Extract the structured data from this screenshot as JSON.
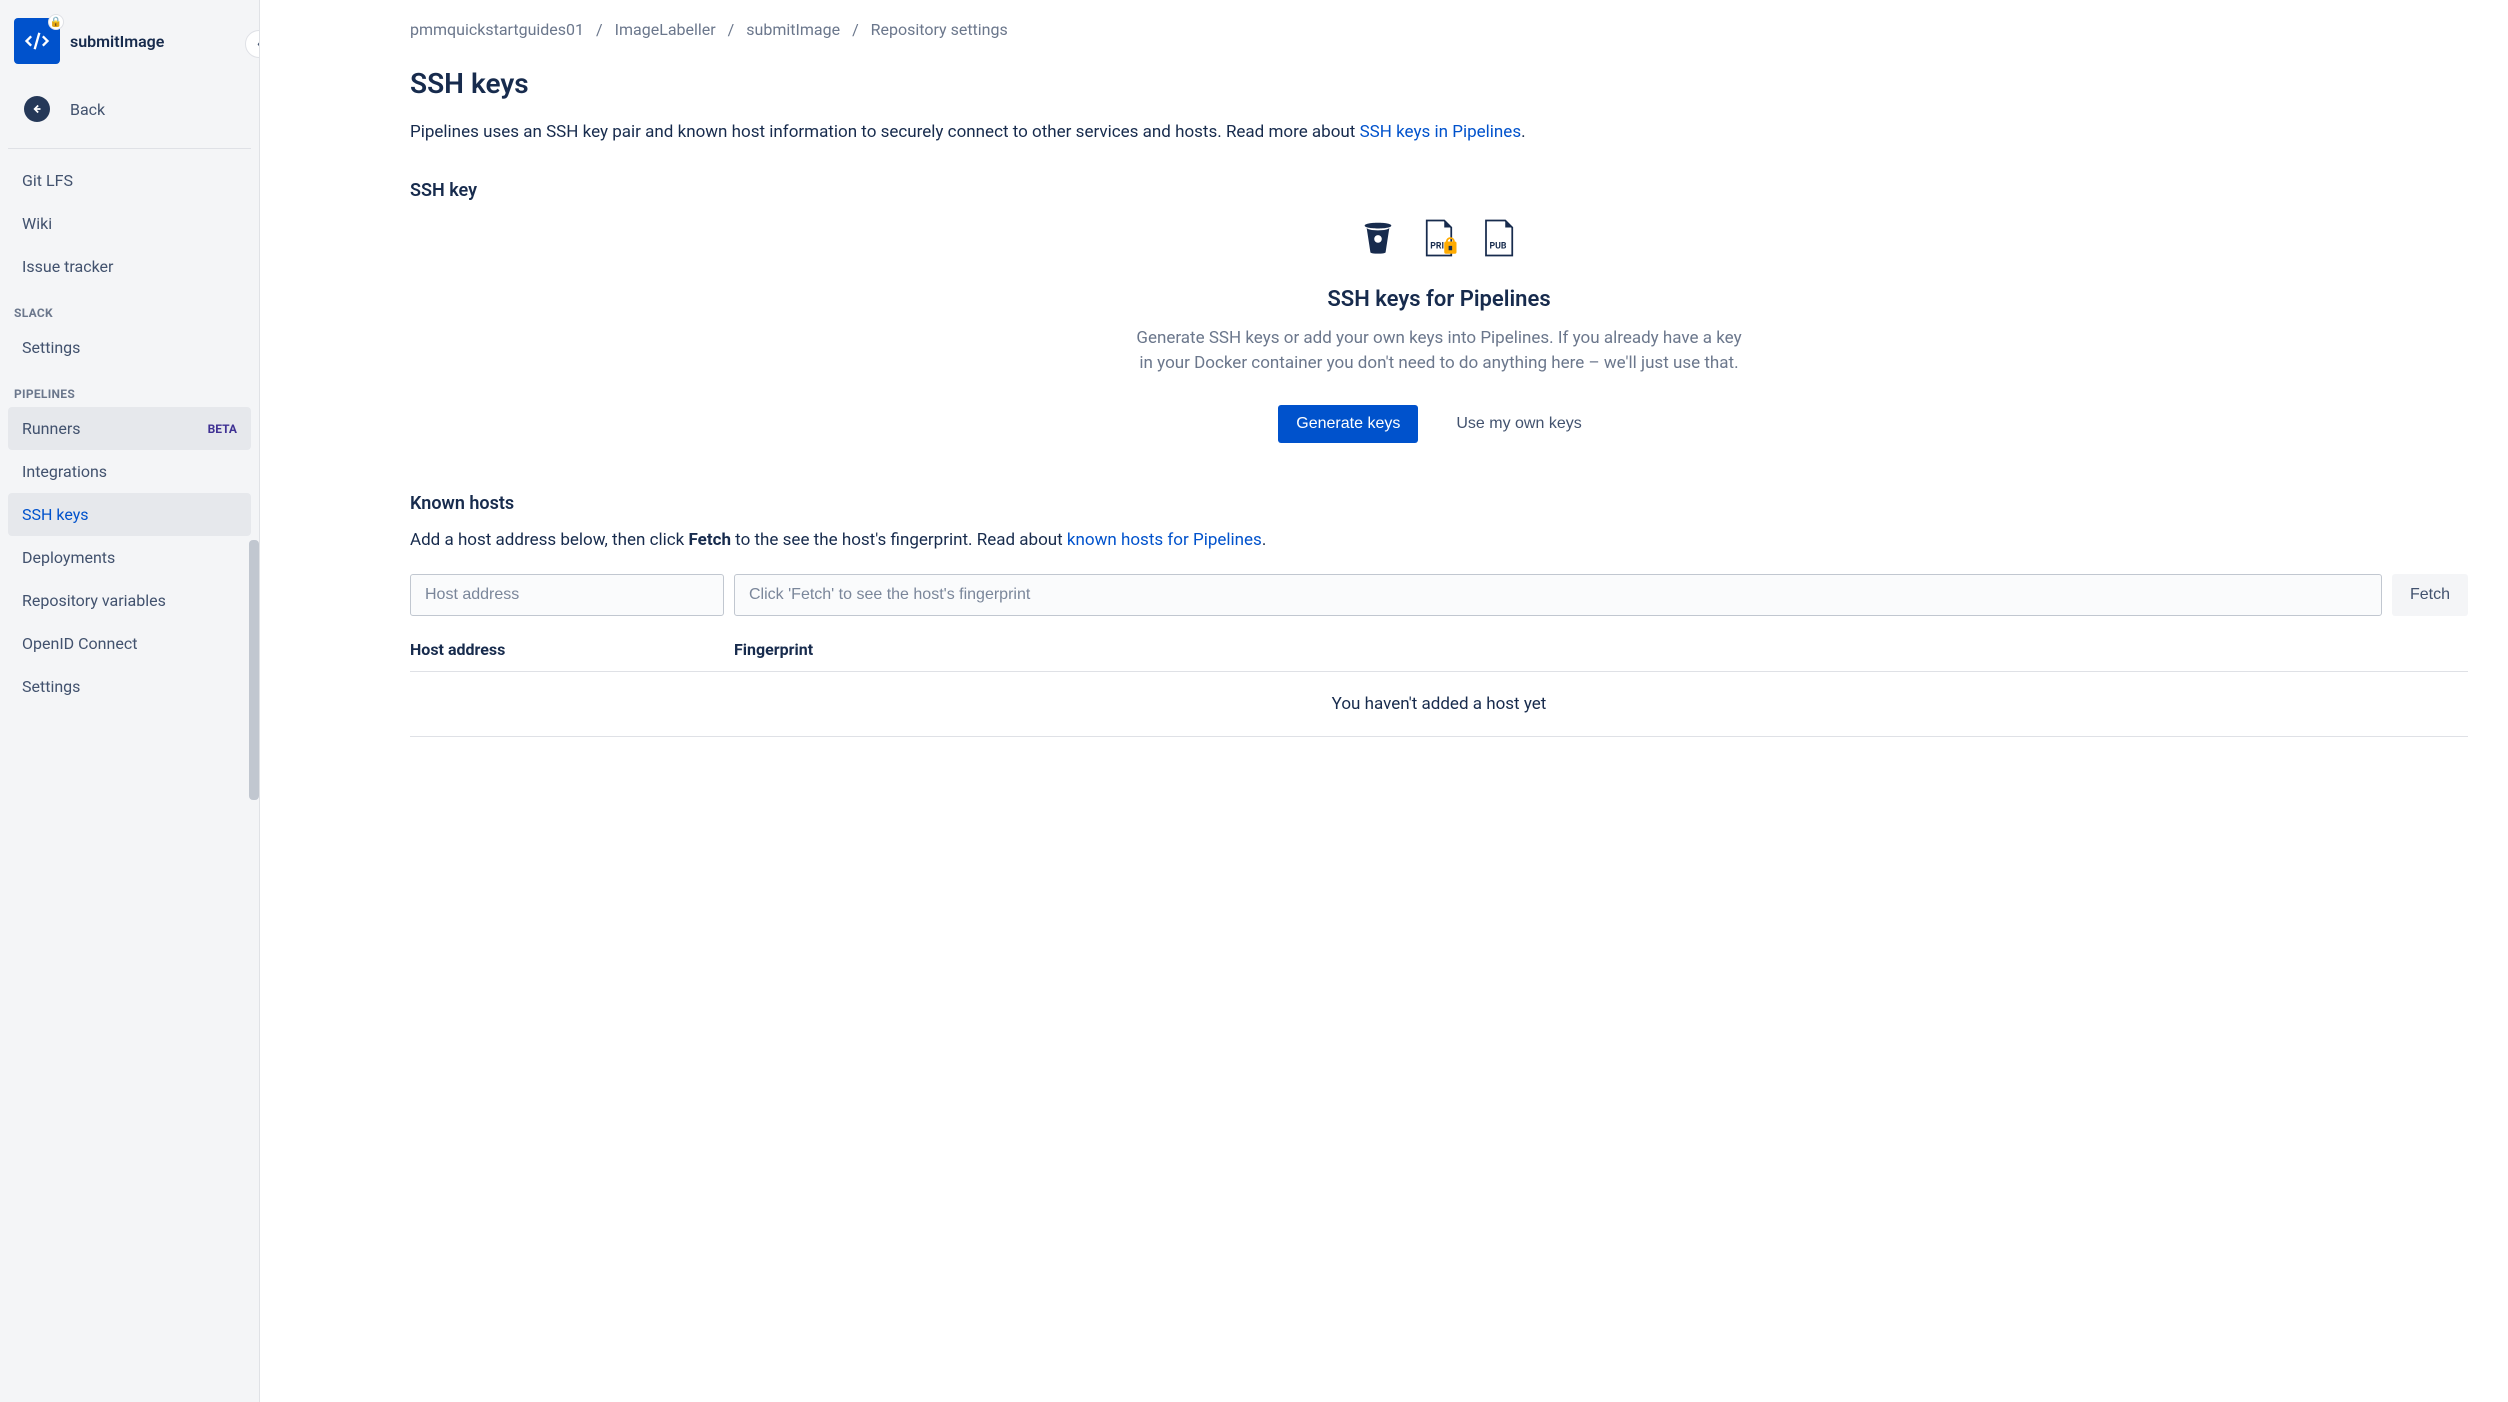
{
  "sidebar": {
    "repoName": "submitImage",
    "backLabel": "Back",
    "nav_general": [
      {
        "label": "Git LFS"
      },
      {
        "label": "Wiki"
      },
      {
        "label": "Issue tracker"
      }
    ],
    "section_slack": "SLACK",
    "nav_slack": [
      {
        "label": "Settings"
      }
    ],
    "section_pipelines": "PIPELINES",
    "runnersLabel": "Runners",
    "runnersBadge": "BETA",
    "nav_pipelines": [
      {
        "label": "Integrations"
      },
      {
        "label": "SSH keys"
      },
      {
        "label": "Deployments"
      },
      {
        "label": "Repository variables"
      },
      {
        "label": "OpenID Connect"
      },
      {
        "label": "Settings"
      }
    ]
  },
  "breadcrumbs": {
    "items": [
      "pmmquickstartguides01",
      "ImageLabeller",
      "submitImage",
      "Repository settings"
    ]
  },
  "page": {
    "title": "SSH keys",
    "intro_prefix": "Pipelines uses an SSH key pair and known host information to securely connect to other services and hosts. Read more about ",
    "intro_link": "SSH keys in Pipelines",
    "intro_suffix": "."
  },
  "sshKeySection": {
    "heading": "SSH key",
    "panelTitle": "SSH keys for Pipelines",
    "panelDesc": "Generate SSH keys or add your own keys into Pipelines. If you already have a key in your Docker container you don't need to do anything here – we'll just use that.",
    "generateBtn": "Generate keys",
    "ownKeysBtn": "Use my own keys",
    "priLabel": "PRI",
    "pubLabel": "PUB"
  },
  "knownHosts": {
    "heading": "Known hosts",
    "desc_pre": "Add a host address below, then click ",
    "desc_bold": "Fetch",
    "desc_mid": " to the see the host's fingerprint. Read about ",
    "desc_link": "known hosts for Pipelines",
    "desc_suffix": ".",
    "hostPlaceholder": "Host address",
    "fpPlaceholder": "Click 'Fetch' to see the host's fingerprint",
    "fetchBtn": "Fetch",
    "col_host": "Host address",
    "col_fp": "Fingerprint",
    "emptyMsg": "You haven't added a host yet"
  }
}
